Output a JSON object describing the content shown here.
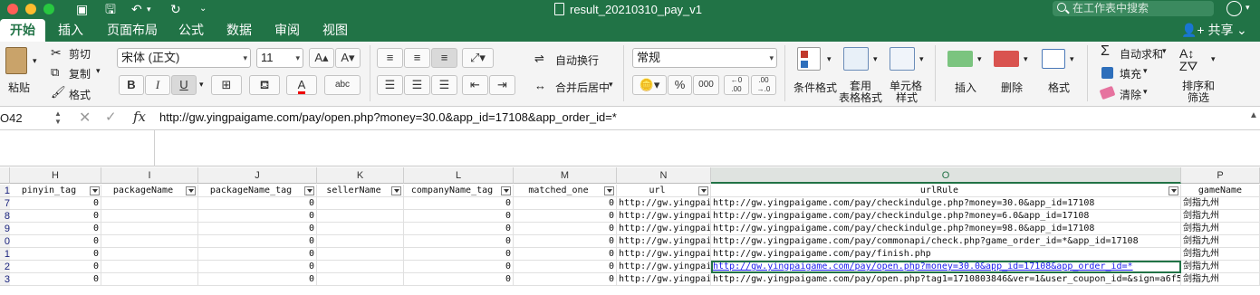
{
  "window": {
    "title": "result_20210310_pay_v1",
    "search_placeholder": "在工作表中搜索"
  },
  "tabs": [
    "开始",
    "插入",
    "页面布局",
    "公式",
    "数据",
    "审阅",
    "视图"
  ],
  "share_label": "共享",
  "ribbon": {
    "paste_label": "粘贴",
    "cut_label": "剪切",
    "copy_label": "复制",
    "format_painter_label": "格式",
    "font_name": "宋体 (正文)",
    "font_size": "11",
    "bold": "B",
    "italic": "I",
    "underline": "U",
    "wrap_label": "自动换行",
    "merge_label": "合并后居中",
    "number_format": "常规",
    "percent": "%",
    "comma": "000",
    "cond_format_label": "条件格式",
    "table_format_label": [
      "套用",
      "表格格式"
    ],
    "cell_style_label": [
      "单元格",
      "样式"
    ],
    "insert_label": "插入",
    "delete_label": "删除",
    "format_label": "格式",
    "autosum_label": "自动求和",
    "fill_label": "填充",
    "clear_label": "清除",
    "sort_label": [
      "排序和",
      "筛选"
    ]
  },
  "formula_bar": {
    "name_box": "O42",
    "fx": "fx",
    "content": "http://gw.yingpaigame.com/pay/open.php?money=30.0&app_id=17108&app_order_id=*"
  },
  "columns": [
    "H",
    "I",
    "J",
    "K",
    "L",
    "M",
    "N",
    "O",
    "P"
  ],
  "header_row": {
    "num": "1",
    "cells": [
      "pinyin_tag",
      "packageName",
      "packageName_tag",
      "sellerName",
      "companyName_tag",
      "matched_one",
      "url",
      "urlRule",
      "gameName"
    ]
  },
  "rows": [
    {
      "num": "7",
      "h": "0",
      "j": "0",
      "l": "0",
      "m": "0",
      "n": "http://gw.yingpai",
      "o": "http://gw.yingpaigame.com/pay/checkindulge.php?money=30.0&app_id=17108",
      "p": "剑指九州"
    },
    {
      "num": "8",
      "h": "0",
      "j": "0",
      "l": "0",
      "m": "0",
      "n": "http://gw.yingpai",
      "o": "http://gw.yingpaigame.com/pay/checkindulge.php?money=6.0&app_id=17108",
      "p": "剑指九州"
    },
    {
      "num": "9",
      "h": "0",
      "j": "0",
      "l": "0",
      "m": "0",
      "n": "http://gw.yingpai",
      "o": "http://gw.yingpaigame.com/pay/checkindulge.php?money=98.0&app_id=17108",
      "p": "剑指九州"
    },
    {
      "num": "0",
      "h": "0",
      "j": "0",
      "l": "0",
      "m": "0",
      "n": "http://gw.yingpai",
      "o": "http://gw.yingpaigame.com/pay/commonapi/check.php?game_order_id=*&app_id=17108",
      "p": "剑指九州"
    },
    {
      "num": "1",
      "h": "0",
      "j": "0",
      "l": "0",
      "m": "0",
      "n": "http://gw.yingpai",
      "o": "http://gw.yingpaigame.com/pay/finish.php",
      "p": "剑指九州"
    },
    {
      "num": "2",
      "h": "0",
      "j": "0",
      "l": "0",
      "m": "0",
      "n": "http://gw.yingpai",
      "o": "http://gw.yingpaigame.com/pay/open.php?money=30.0&app_id=17108&app_order_id=*",
      "p": "剑指九州",
      "selected": true
    },
    {
      "num": "3",
      "h": "0",
      "j": "0",
      "l": "0",
      "m": "0",
      "n": "http://gw.yingpai",
      "o": "http://gw.yingpaigame.com/pay/open.php?tag1=1710803846&ver=1&user_coupon_id=&sign=a6f5",
      "p": "剑指九州"
    }
  ],
  "colors": {
    "excel_green": "#217346",
    "link": "#1a1aee"
  }
}
